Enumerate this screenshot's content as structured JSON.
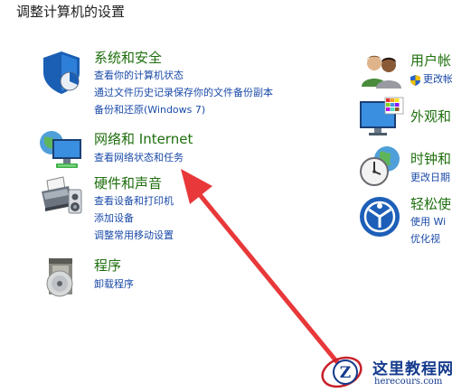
{
  "page_title": "调整计算机的设置",
  "categories": {
    "system": {
      "title": "系统和安全",
      "links": [
        "查看你的计算机状态",
        "通过文件历史记录保存你的文件备份副本",
        "备份和还原(Windows 7)"
      ]
    },
    "network": {
      "title": "网络和 Internet",
      "links": [
        "查看网络状态和任务"
      ]
    },
    "hardware": {
      "title": "硬件和声音",
      "links": [
        "查看设备和打印机",
        "添加设备",
        "调整常用移动设置"
      ]
    },
    "programs": {
      "title": "程序",
      "links": [
        "卸载程序"
      ]
    },
    "user_accounts": {
      "title": "用户帐",
      "links": [
        "更改帐"
      ]
    },
    "appearance": {
      "title": "外观和"
    },
    "clock": {
      "title": "时钟和",
      "links": [
        "更改日期"
      ]
    },
    "ease": {
      "title": "轻松使",
      "links": [
        "使用 Wi",
        "优化视"
      ]
    }
  },
  "watermark": {
    "name": "这里教程网",
    "url": "herecours.com"
  },
  "colors": {
    "category_title": "#1f6f0e",
    "link": "#1a4aa8",
    "annotation_arrow": "#e8383a",
    "watermark": "#143a8c"
  },
  "icons": {
    "system": "shield-icon",
    "network": "network-globe-icon",
    "hardware": "printer-icon",
    "programs": "program-disk-icon",
    "user_accounts": "users-icon",
    "appearance": "monitor-palette-icon",
    "clock": "clock-globe-icon",
    "ease": "ease-of-access-icon"
  }
}
